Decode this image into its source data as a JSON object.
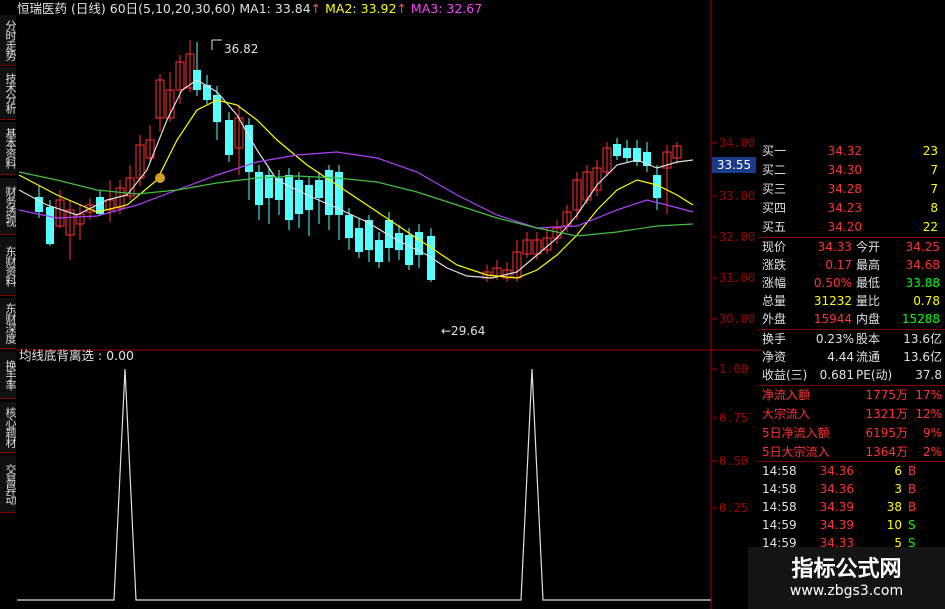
{
  "header": {
    "stock_name": "恒瑞医药",
    "period": "(日线)",
    "ma_config": "60日(5,10,20,30,60)",
    "ma1_label": "MA1:",
    "ma1_value": "33.84",
    "ma2_label": "MA2:",
    "ma2_value": "33.92",
    "ma3_label": "MA3:",
    "ma3_value": "32.67"
  },
  "sidebar_tabs": [
    "分时走势",
    "技术分析",
    "基本资料",
    "财务透视",
    "东财资料",
    "东财深度",
    "换手率",
    "核心题材",
    "交易异动"
  ],
  "kline": {
    "high_annotation": "36.82",
    "low_annotation": "←29.64",
    "price_axis": [
      "34.00",
      "33.00",
      "32.00",
      "31.00",
      "30.00"
    ],
    "current_price_tag": "33.55"
  },
  "indicator": {
    "title": "均线底背离选 : 0.00",
    "axis": [
      "1.00",
      "0.75",
      "0.50",
      "0.25"
    ]
  },
  "orderbook": [
    {
      "label": "买一",
      "price": "34.32",
      "vol": "23"
    },
    {
      "label": "买二",
      "price": "34.30",
      "vol": "7"
    },
    {
      "label": "买三",
      "price": "34.28",
      "vol": "7"
    },
    {
      "label": "买四",
      "price": "34.23",
      "vol": "8"
    },
    {
      "label": "买五",
      "price": "34.20",
      "vol": "22"
    }
  ],
  "quote": [
    {
      "l1": "现价",
      "v1": "34.33",
      "c1": "red",
      "l2": "今开",
      "v2": "34.25",
      "c2": "red"
    },
    {
      "l1": "涨跌",
      "v1": "0.17",
      "c1": "red",
      "l2": "最高",
      "v2": "34.68",
      "c2": "red"
    },
    {
      "l1": "涨幅",
      "v1": "0.50%",
      "c1": "red",
      "l2": "最低",
      "v2": "33.88",
      "c2": "grn2"
    },
    {
      "l1": "总量",
      "v1": "31232",
      "c1": "yel",
      "l2": "量比",
      "v2": "0.78",
      "c2": "yel"
    },
    {
      "l1": "外盘",
      "v1": "15944",
      "c1": "red",
      "l2": "内盘",
      "v2": "15288",
      "c2": "grn2"
    }
  ],
  "fundamentals": [
    {
      "l1": "换手",
      "v1": "0.23%",
      "l2": "股本",
      "v2": "13.6亿"
    },
    {
      "l1": "净资",
      "v1": "4.44",
      "l2": "流通",
      "v2": "13.6亿"
    },
    {
      "l1": "收益(三)",
      "v1": "0.681",
      "l2": "PE(动)",
      "v2": "37.8"
    }
  ],
  "flows": [
    {
      "label": "净流入额",
      "v": "1775万",
      "p": "17%"
    },
    {
      "label": "大宗流入",
      "v": "1321万",
      "p": "12%"
    },
    {
      "label": "5日净流入额",
      "v": "6195万",
      "p": "9%"
    },
    {
      "label": "5日大宗流入",
      "v": "1364万",
      "p": "2%"
    }
  ],
  "ticks": [
    {
      "t": "14:58",
      "p": "34.36",
      "v": "6",
      "s": "B",
      "c": "red"
    },
    {
      "t": "14:58",
      "p": "34.36",
      "v": "3",
      "s": "B",
      "c": "red"
    },
    {
      "t": "14:58",
      "p": "34.39",
      "v": "38",
      "s": "B",
      "c": "red"
    },
    {
      "t": "14:59",
      "p": "34.39",
      "v": "10",
      "s": "S",
      "c": "grn2"
    },
    {
      "t": "14:59",
      "p": "34.33",
      "v": "5",
      "s": "S",
      "c": "grn2"
    }
  ],
  "watermark": {
    "title": "指标公式网",
    "url": "www.zbgs3.com"
  }
}
